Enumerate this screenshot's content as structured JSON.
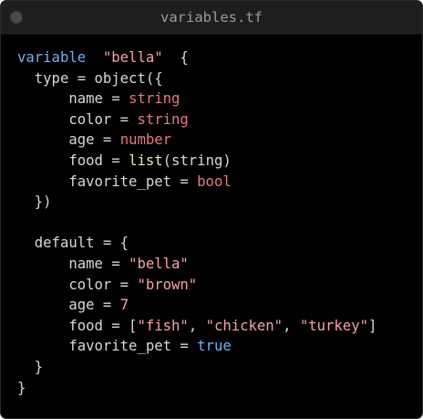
{
  "window": {
    "title": "variables.tf"
  },
  "code": {
    "l1": {
      "kw": "variable",
      "name": "\"bella\"",
      "brace": "{"
    },
    "l2": "type = object({",
    "l3": {
      "key": "name = ",
      "val": "string"
    },
    "l4": {
      "key": "color = ",
      "val": "string"
    },
    "l5": {
      "key": "age = ",
      "val": "number"
    },
    "l6": {
      "key": "food = ",
      "fn": "list",
      "rest": "(string)"
    },
    "l7": {
      "key": "favorite_pet = ",
      "val": "bool"
    },
    "l8": "})",
    "l10": "default = {",
    "l11": {
      "key": "name = ",
      "val": "\"bella\""
    },
    "l12": {
      "key": "color = ",
      "val": "\"brown\""
    },
    "l13": {
      "key": "age = ",
      "val": "7"
    },
    "l14": {
      "key": "food = [",
      "v1": "\"fish\"",
      "sep1": ", ",
      "v2": "\"chicken\"",
      "sep2": ", ",
      "v3": "\"turkey\"",
      "end": "]"
    },
    "l15": {
      "key": "favorite_pet = ",
      "val": "true"
    },
    "l16": "}",
    "l17": "}"
  }
}
